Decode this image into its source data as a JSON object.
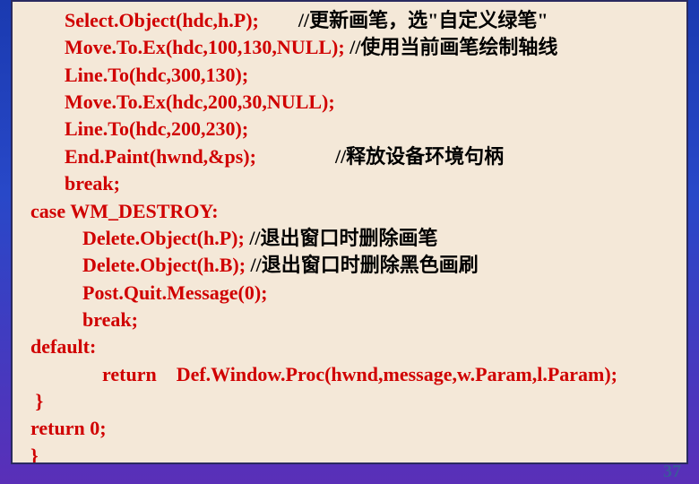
{
  "lines": [
    {
      "cls": "i1",
      "code": "Select.Object(hdc,h.P);　",
      "comment": "　//更新画笔，选\"自定义绿笔\""
    },
    {
      "cls": "i1",
      "code": "Move.To.Ex(hdc,100,130,NULL); ",
      "comment": "//使用当前画笔绘制轴线"
    },
    {
      "cls": "i1",
      "code": "Line.To(hdc,300,130);",
      "comment": ""
    },
    {
      "cls": "i1",
      "code": "Move.To.Ex(hdc,200,30,NULL);",
      "comment": ""
    },
    {
      "cls": "i1",
      "code": "Line.To(hdc,200,230);",
      "comment": ""
    },
    {
      "cls": "i1",
      "code": "End.Paint(hwnd,&ps);　　　",
      "comment": "　//释放设备环境句柄"
    },
    {
      "cls": "i1",
      "code": "break;",
      "comment": ""
    },
    {
      "cls": "i0",
      "code": "case WM_DESTROY:",
      "comment": ""
    },
    {
      "cls": "i2",
      "code": "Delete.Object(h.P); ",
      "comment": "//退出窗口时删除画笔"
    },
    {
      "cls": "i2",
      "code": "Delete.Object(h.B); ",
      "comment": "//退出窗口时删除黑色画刷"
    },
    {
      "cls": "i2",
      "code": "Post.Quit.Message(0);",
      "comment": ""
    },
    {
      "cls": "i2",
      "code": "break;",
      "comment": ""
    },
    {
      "cls": "i0",
      "code": "default:",
      "comment": ""
    },
    {
      "cls": "i3",
      "code": "return　Def.Window.Proc(hwnd,message,w.Param,l.Param);",
      "comment": ""
    },
    {
      "cls": "i0",
      "code": " }",
      "comment": ""
    },
    {
      "cls": "i0",
      "code": "return 0;",
      "comment": ""
    },
    {
      "cls": "i0",
      "code": "}",
      "comment": ""
    }
  ],
  "page_number": "37"
}
